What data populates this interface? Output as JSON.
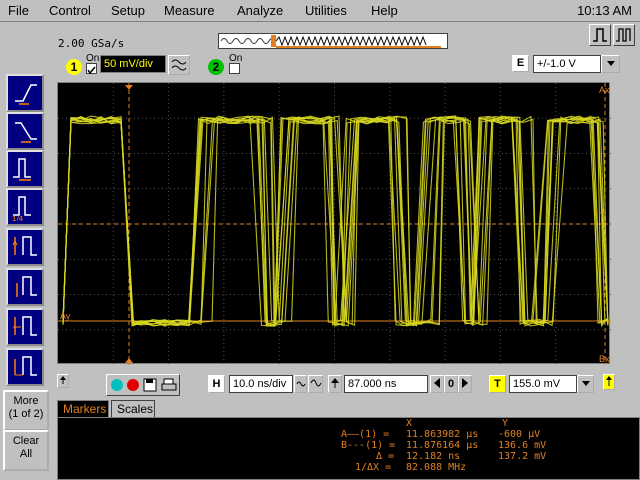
{
  "menu": {
    "items": [
      {
        "label": "File"
      },
      {
        "label": "Control"
      },
      {
        "label": "Setup"
      },
      {
        "label": "Measure"
      },
      {
        "label": "Analyze"
      },
      {
        "label": "Utilities"
      },
      {
        "label": "Help"
      }
    ],
    "clock": "10:13 AM"
  },
  "header": {
    "sample_rate": "2.00 GSa/s"
  },
  "channel1": {
    "number": "1",
    "on_label": "On",
    "scale": "50 mV/div",
    "color": "#ffff00"
  },
  "channel2": {
    "number": "2",
    "on_label": "On",
    "color": "#00c000"
  },
  "trigger_mode": {
    "letter": "E",
    "value": "+/-1.0 V"
  },
  "screen": {
    "marker_a_label": "Ax",
    "marker_b_label": "Bx",
    "marker_ay_label": "Ay",
    "trigger_level_label": "T",
    "trace_color": "#d8d820",
    "marker_color": "#e08020"
  },
  "timebase": {
    "h_letter": "H",
    "scale": "10.0 ns/div",
    "delay": "87.000 ns",
    "zero_label": "0",
    "t_letter": "T",
    "trigger_level": "155.0 mV"
  },
  "side_buttons": {
    "more": "More\n(1 of 2)",
    "more_line1": "More",
    "more_line2": "(1 of 2)",
    "clear_line1": "Clear",
    "clear_line2": "All"
  },
  "tabs": [
    {
      "label": "Markers",
      "active": true
    },
    {
      "label": "Scales",
      "active": false
    }
  ],
  "markers_readout": {
    "col_x": "X",
    "col_y": "Y",
    "rows": [
      {
        "label": "A——(1) =",
        "x": "11.863982 µs",
        "y": "-600 µV"
      },
      {
        "label": "B---(1) =",
        "x": "11.876164 µs",
        "y": "136.6 mV"
      },
      {
        "label": "Δ =",
        "x": "12.182 ns",
        "y": "137.2 mV"
      },
      {
        "label": "1/ΔX =",
        "x": "82.088 MHz",
        "y": ""
      }
    ]
  }
}
